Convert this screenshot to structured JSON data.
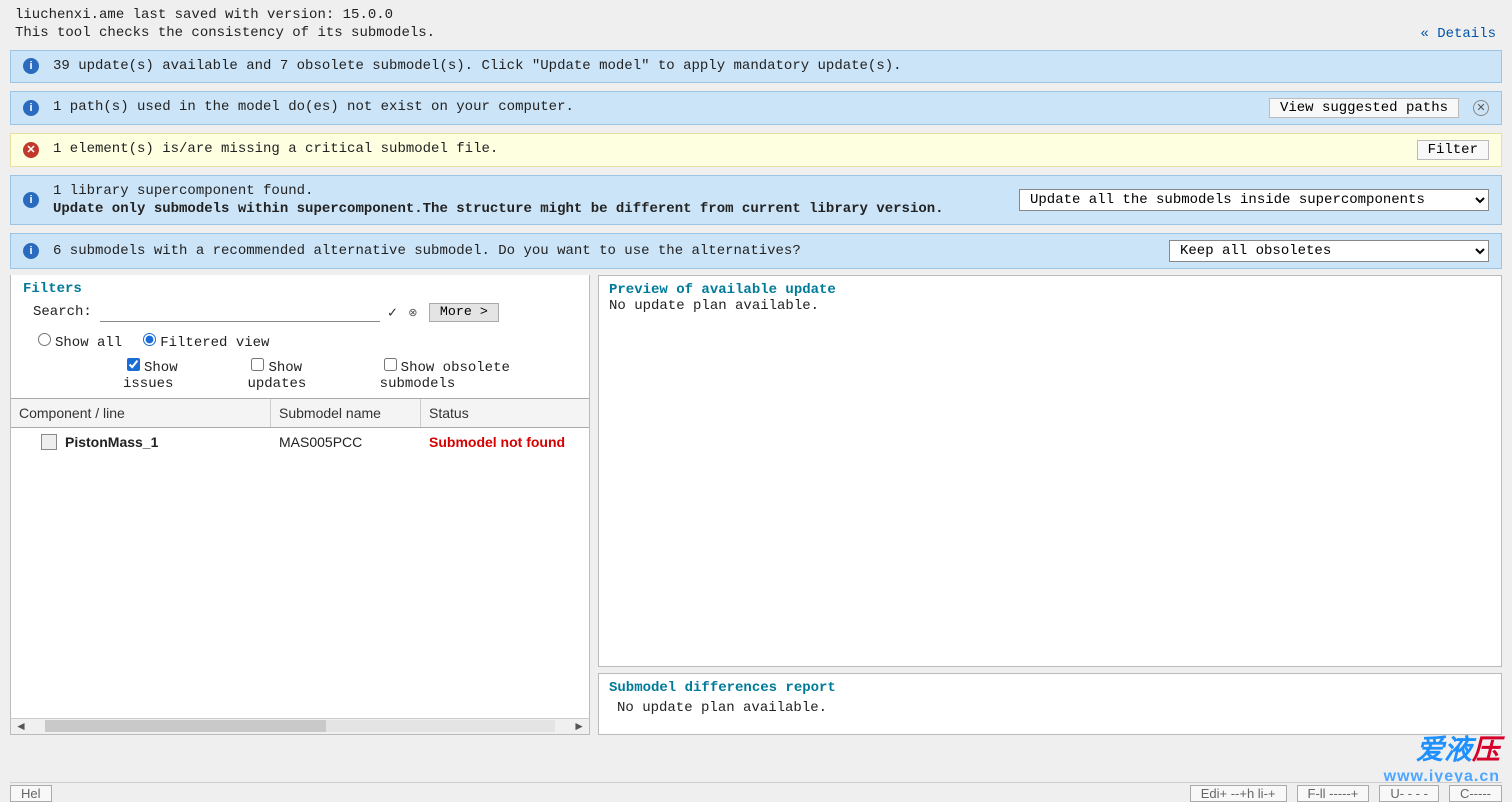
{
  "header": {
    "line1": "liuchenxi.ame last saved with version: 15.0.0",
    "line2": "This tool checks the consistency of its submodels.",
    "details_label": "Details"
  },
  "banners": {
    "b1": "39 update(s) available and 7 obsolete submodel(s). Click \"Update model\" to apply mandatory update(s).",
    "b2": {
      "text": "1 path(s) used in the model do(es) not exist on your computer.",
      "button": "View suggested paths"
    },
    "b3": {
      "text": "1 element(s) is/are missing a critical submodel file.",
      "button": "Filter"
    },
    "b4": {
      "line1": "1 library supercomponent found.",
      "line2": "Update only submodels within supercomponent.The structure might be different from current library version.",
      "select": "Update all the submodels inside supercomponents"
    },
    "b5": {
      "text": "6 submodels with a recommended alternative submodel. Do you want to use the alternatives?",
      "select": "Keep all obsoletes"
    }
  },
  "filters": {
    "title": "Filters",
    "search_label": "Search:",
    "more_label": "More >",
    "show_all": "Show all",
    "filtered_view": "Filtered view",
    "show_issues": "Show issues",
    "show_updates": "Show updates",
    "show_obsolete": "Show obsolete submodels"
  },
  "grid": {
    "columns": [
      "Component / line",
      "Submodel name",
      "Status"
    ],
    "rows": [
      {
        "component": "PistonMass_1",
        "submodel": "MAS005PCC",
        "status": "Submodel not found"
      }
    ]
  },
  "preview": {
    "title": "Preview of available update",
    "body": "No update plan available."
  },
  "diff": {
    "title": "Submodel differences report",
    "body": "No update plan available."
  },
  "watermark": {
    "line1_a": "爱液",
    "line1_b": "压",
    "line2": "www.iyeya.cn"
  },
  "footer": {
    "help": "Hel",
    "b1": "Edi+  --+h li-+",
    "b2": "F-ll -----+",
    "b3": "U- - - -",
    "b4": "C-----"
  }
}
